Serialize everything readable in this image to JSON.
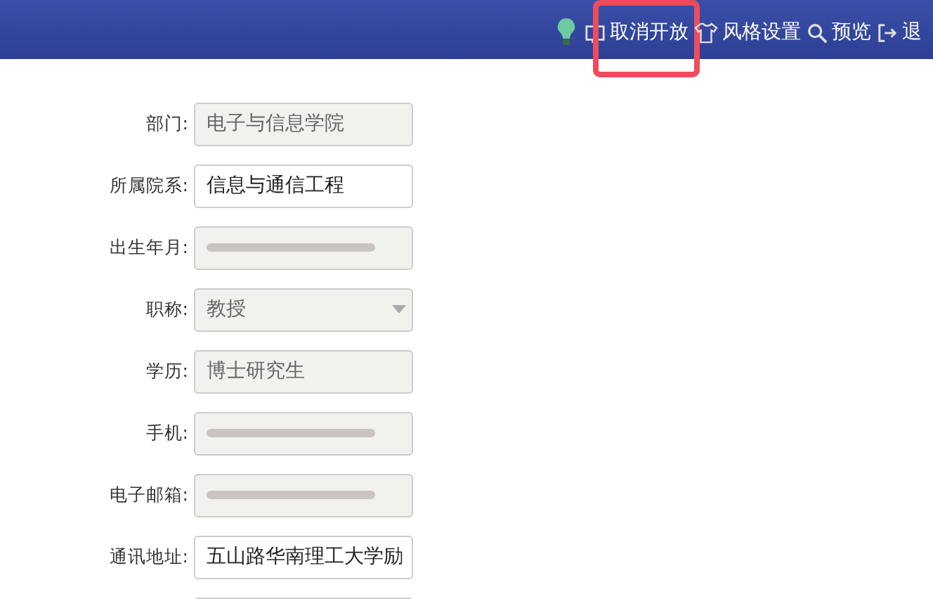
{
  "toolbar": [
    {
      "kind": "bulb"
    },
    {
      "kind": "link",
      "label": "取消开放",
      "highlighted": true
    },
    {
      "kind": "link",
      "label": "风格设置",
      "highlighted": false
    },
    {
      "kind": "link",
      "label": "预览",
      "highlighted": false
    },
    {
      "kind": "link",
      "label": "退",
      "highlighted": false
    }
  ],
  "form": [
    {
      "label": "部门:",
      "kind": "readonly",
      "value": "电子与信息学院"
    },
    {
      "label": "所属院系:",
      "kind": "input",
      "value": "信息与通信工程"
    },
    {
      "label": "出生年月:",
      "kind": "blurred"
    },
    {
      "label": "职称:",
      "kind": "select",
      "value": "教授"
    },
    {
      "label": "学历:",
      "kind": "readonly",
      "value": "博士研究生"
    },
    {
      "label": "手机:",
      "kind": "blurred"
    },
    {
      "label": "电子邮箱:",
      "kind": "blurred"
    },
    {
      "label": "通讯地址:",
      "kind": "input",
      "value": "五山路华南理工大学励"
    },
    {
      "kind": "input"
    }
  ]
}
